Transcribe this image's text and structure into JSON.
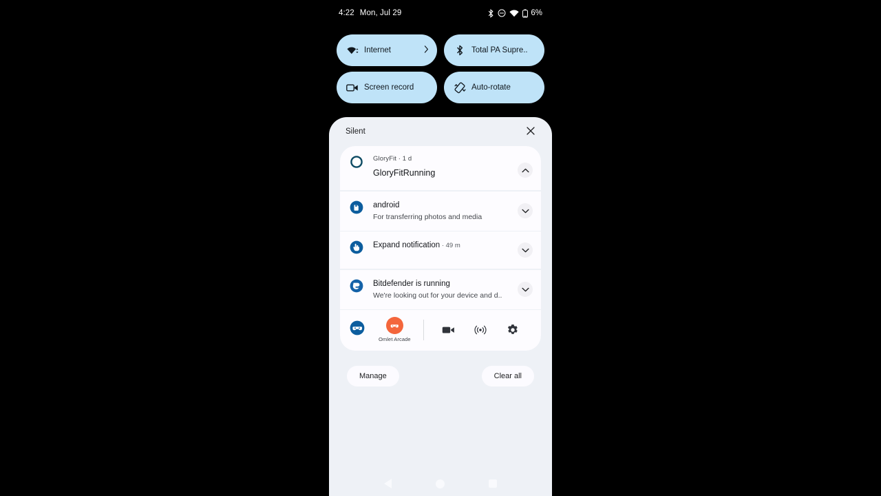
{
  "statusbar": {
    "time": "4:22",
    "date": "Mon, Jul 29",
    "battery_percent": "6%",
    "icons": [
      "bluetooth-icon",
      "do-not-disturb-icon",
      "wifi-icon",
      "battery-icon"
    ]
  },
  "quick_settings": {
    "tiles": [
      {
        "label": "Internet",
        "icon": "wifi-icon",
        "has_chevron": true
      },
      {
        "label": "Total PA Supre..",
        "icon": "bluetooth-icon",
        "has_chevron": false
      },
      {
        "label": "Screen record",
        "icon": "screen-record-icon",
        "has_chevron": false
      },
      {
        "label": "Auto-rotate",
        "icon": "auto-rotate-icon",
        "has_chevron": false
      }
    ],
    "accent_color": "#bfe3f8"
  },
  "shade": {
    "section_title": "Silent",
    "close_label": "close-icon",
    "background_color": "#eef1f6",
    "card_color": "#fdfcff"
  },
  "notifications": [
    {
      "app": "GloryFit",
      "time": "1 d",
      "appline": "GloryFit · 1 d",
      "title": "GloryFitRunning",
      "text": "",
      "icon": "gloryfit-ring-icon",
      "icon_color": "#0d4a63",
      "expanded": true,
      "chevron": "chevron-up-icon"
    },
    {
      "app": "android",
      "time": "",
      "appline": "",
      "title": "android",
      "text": "For transferring photos and media",
      "icon": "usb-icon",
      "icon_color": "#0c5d9e",
      "expanded": false,
      "chevron": "chevron-down-icon"
    },
    {
      "app": "Expand notification",
      "time": "49 m",
      "appline": "",
      "title": "Expand notification",
      "title_time": " · 49 m",
      "text": "",
      "icon": "pointer-icon",
      "icon_color": "#0c5d9e",
      "expanded": false,
      "chevron": "chevron-down-icon"
    },
    {
      "app": "Bitdefender",
      "time": "",
      "appline": "",
      "title": "Bitdefender is running",
      "text": "We're looking out for your device and d..",
      "icon": "bitdefender-shield-icon",
      "icon_color": "#1462a8",
      "expanded": false,
      "chevron": "chevron-down-icon"
    }
  ],
  "arcade_row": {
    "bubble_icon": "gamepad-bubble-icon",
    "bubble_color": "#0c5d9e",
    "avatar_label": "Omlet Arcade",
    "avatar_color": "#f4663c",
    "actions": [
      {
        "name": "record-video-icon"
      },
      {
        "name": "broadcast-live-icon"
      },
      {
        "name": "settings-gear-icon"
      }
    ]
  },
  "footer": {
    "manage_label": "Manage",
    "clear_all_label": "Clear all"
  },
  "navbar": {
    "back": "back-triangle-icon",
    "home": "home-circle-icon",
    "recents": "recents-square-icon"
  }
}
